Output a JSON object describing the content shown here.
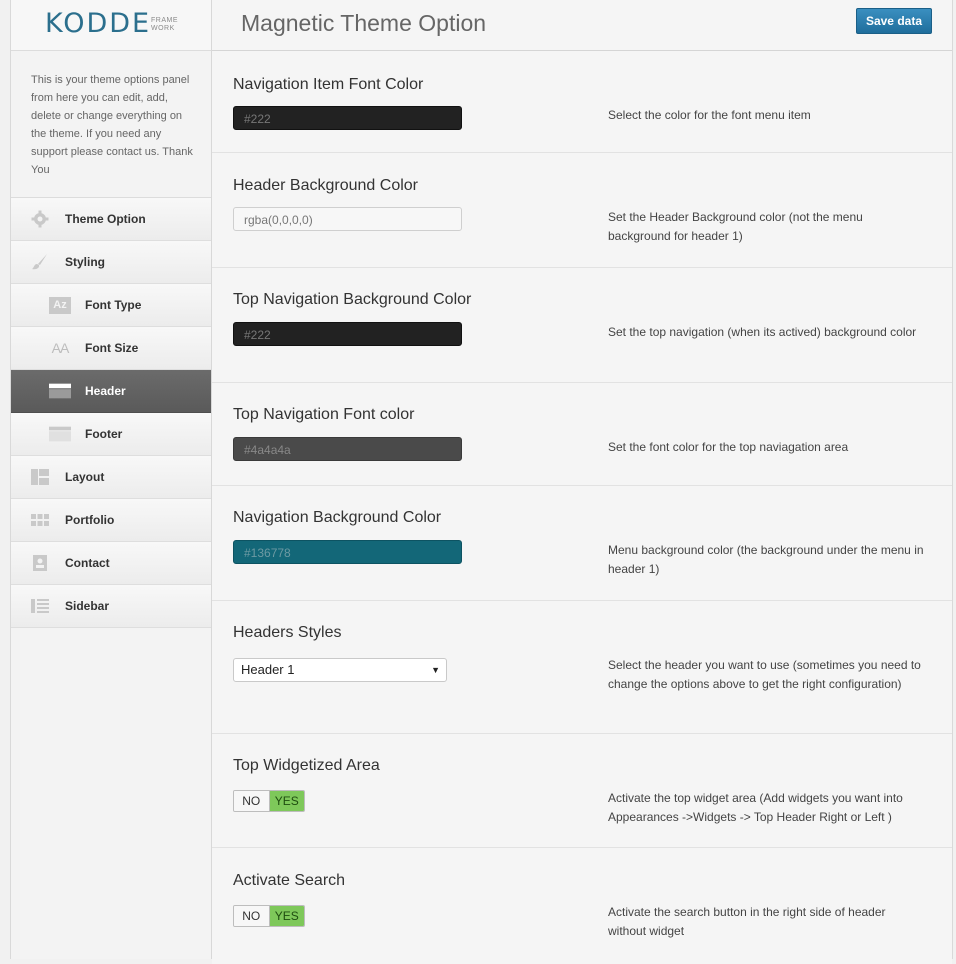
{
  "logo": {
    "main": "KODDE",
    "sub_line1": "FRAME",
    "sub_line2": "WORK"
  },
  "sidebar": {
    "intro": "This is your theme options panel from here you can edit, add, delete or change everything on the theme. If you need any support please contact us. Thank You",
    "items": [
      {
        "label": "Theme Option",
        "icon": "gear-icon"
      },
      {
        "label": "Styling",
        "icon": "brush-icon"
      },
      {
        "label": "Font Type",
        "icon": "font-type-icon"
      },
      {
        "label": "Font Size",
        "icon": "font-size-icon"
      },
      {
        "label": "Header",
        "icon": "header-icon"
      },
      {
        "label": "Footer",
        "icon": "footer-icon"
      },
      {
        "label": "Layout",
        "icon": "layout-icon"
      },
      {
        "label": "Portfolio",
        "icon": "portfolio-grid-icon"
      },
      {
        "label": "Contact",
        "icon": "contact-icon"
      },
      {
        "label": "Sidebar",
        "icon": "sidebar-list-icon"
      }
    ],
    "font_type_glyph": "Az",
    "font_size_glyph": "AA"
  },
  "header": {
    "title": "Magnetic Theme Option",
    "save_label": "Save data"
  },
  "options": [
    {
      "title": "Navigation Item Font Color",
      "value": "#222",
      "desc": "Select the color for the font menu item",
      "color": "#222222"
    },
    {
      "title": "Header Background Color",
      "value": "rgba(0,0,0,0)",
      "desc": "Set the Header Background color (not the menu background for header 1)",
      "color": "#f7f7f7"
    },
    {
      "title": "Top Navigation Background Color",
      "value": "#222",
      "desc": "Set the top navigation (when its actived) background color",
      "color": "#222222"
    },
    {
      "title": "Top Navigation Font color",
      "value": "#4a4a4a",
      "desc": "Set the font color for the top naviagation area",
      "color": "#4a4a4a"
    },
    {
      "title": "Navigation Background Color",
      "value": "#136778",
      "desc": "Menu background color (the background under the menu in header 1)",
      "color": "#136778"
    },
    {
      "title": "Headers Styles",
      "value": "Header 1",
      "desc": "Select the header you want to use (sometimes you need to change the options above to get the right configuration)"
    },
    {
      "title": "Top Widgetized Area",
      "no": "NO",
      "yes": "YES",
      "desc": "Activate the top widget area (Add widgets you want into Appearances ->Widgets -> Top Header Right or Left )"
    },
    {
      "title": "Activate Search",
      "no": "NO",
      "yes": "YES",
      "desc": "Activate the search button in the right side of header without widget"
    }
  ],
  "colors": {
    "accent": "#2b6f8d",
    "save_button": "#2a80b3",
    "active_nav": "#5f5f5f",
    "toggle_yes": "#7ec85a"
  }
}
